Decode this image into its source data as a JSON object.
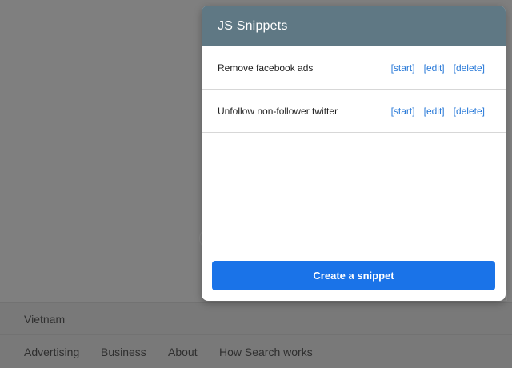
{
  "background_page": {
    "country": "Vietnam",
    "footer_links": [
      "Advertising",
      "Business",
      "About",
      "How Search works"
    ]
  },
  "popup": {
    "title": "JS Snippets",
    "action_labels": {
      "start": "[start]",
      "edit": "[edit]",
      "delete": "[delete]"
    },
    "snippets": [
      {
        "name": "Remove facebook ads"
      },
      {
        "name": "Unfollow non-follower twitter"
      }
    ],
    "create_button_label": "Create a snippet"
  },
  "colors": {
    "header_bg": "#5f7884",
    "link": "#2a7ad8",
    "primary_button": "#1a73e8",
    "overlay": "#7f7f7f"
  }
}
